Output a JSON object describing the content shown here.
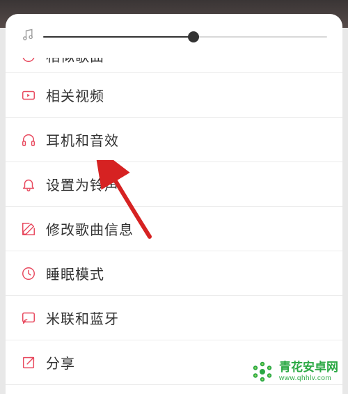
{
  "slider": {
    "value_percent": 53
  },
  "menu": {
    "items": [
      {
        "icon": "similar-icon",
        "label": "相似歌曲"
      },
      {
        "icon": "video-icon",
        "label": "相关视频"
      },
      {
        "icon": "headphone-icon",
        "label": "耳机和音效"
      },
      {
        "icon": "bell-icon",
        "label": "设置为铃声"
      },
      {
        "icon": "edit-icon",
        "label": "修改歌曲信息"
      },
      {
        "icon": "sleep-icon",
        "label": "睡眠模式"
      },
      {
        "icon": "cast-icon",
        "label": "米联和蓝牙"
      },
      {
        "icon": "share-icon",
        "label": "分享"
      }
    ]
  },
  "watermark": {
    "title": "青花安卓网",
    "sub": "www.qhhlv.com"
  },
  "colors": {
    "accent": "#e84a5f",
    "brand": "#2aa843"
  }
}
